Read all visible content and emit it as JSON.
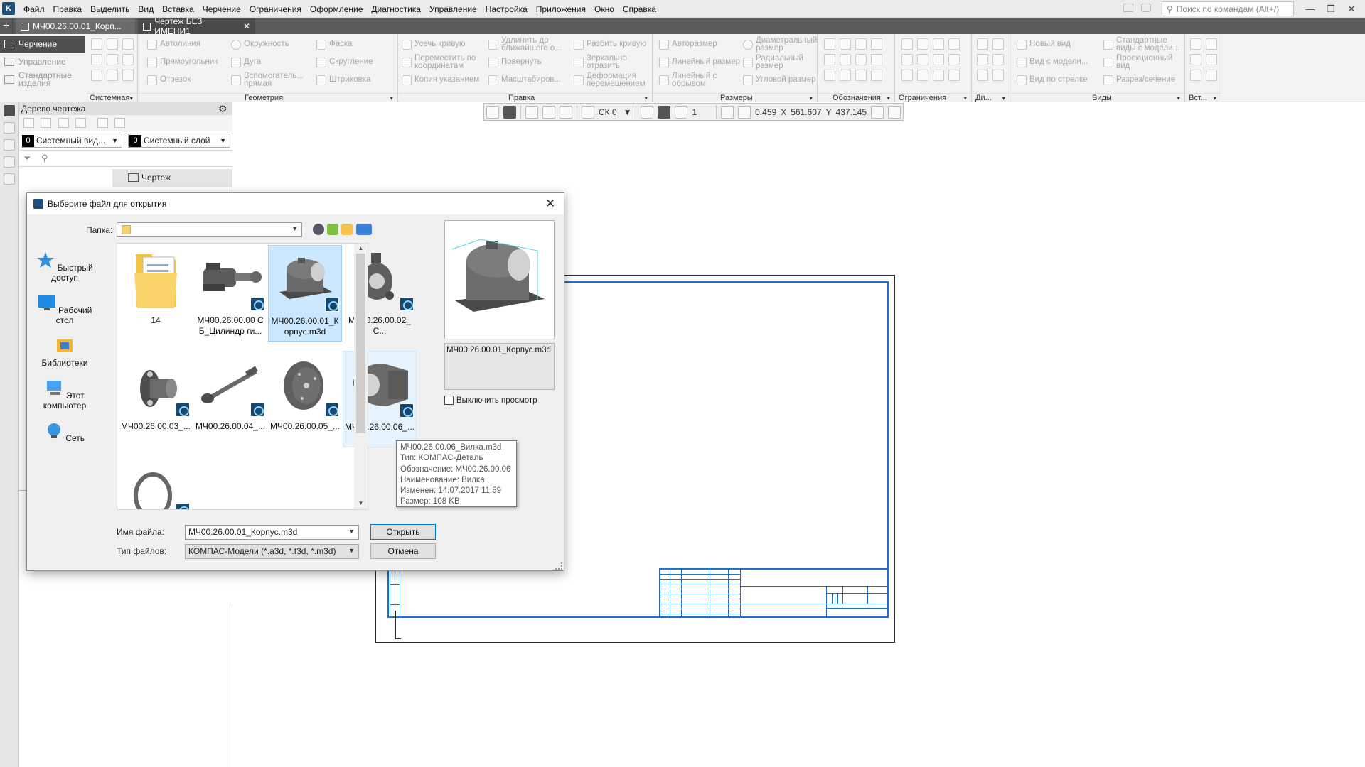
{
  "app": {
    "menu": [
      "Файл",
      "Правка",
      "Выделить",
      "Вид",
      "Вставка",
      "Черчение",
      "Ограничения",
      "Оформление",
      "Диагностика",
      "Управление",
      "Настройка",
      "Приложения",
      "Окно",
      "Справка"
    ],
    "search_placeholder": "Поиск по командам (Alt+/)"
  },
  "tabs": [
    {
      "label": "МЧ00.26.00.01_Корп..."
    },
    {
      "label": "Чертеж БЕЗ ИМЕНИ1",
      "close": "✕"
    }
  ],
  "modes": [
    "Черчение",
    "Управление",
    "Стандартные изделия"
  ],
  "ribbon": {
    "groups": [
      "Системная",
      "Геометрия",
      "Правка",
      "Размеры",
      "Обозначения",
      "Ограничения",
      "Ди...",
      "Виды",
      "Вст..."
    ],
    "geometry": [
      "Автолиния",
      "Окружность",
      "Фаска",
      "Прямоугольник",
      "Дуга",
      "Скругление",
      "Отрезок",
      "Вспомогатель... прямая",
      "Штриховка"
    ],
    "edit": [
      "Усечь кривую",
      "Удлинить до ближайшего о...",
      "Разбить кривую",
      "Переместить по координатам",
      "Повернуть",
      "Зеркально отразить",
      "Копия указанием",
      "Масштабиров...",
      "Деформация перемещением"
    ],
    "dims": [
      "Авторазмер",
      "Диаметральный размер",
      "Линейный размер",
      "Радиальный размер",
      "Линейный с обрывом",
      "Угловой размер"
    ],
    "views": [
      "Новый вид",
      "Стандартные виды с модели...",
      "Вид с модели...",
      "Проекционный вид",
      "Вид по стрелке",
      "Разрез/сечение"
    ]
  },
  "tree": {
    "title": "Дерево чертежа",
    "view_num": "0",
    "view_name": "Системный вид...",
    "layer_num": "0",
    "layer_name": "Системный слой",
    "root_node": "Чертеж"
  },
  "cursor_toolbar": {
    "cs": "СК 0",
    "scale_num": "1",
    "zoom": "0.459",
    "x_label": "X",
    "x_value": "561.607",
    "y_label": "Y",
    "y_value": "437.145"
  },
  "dialog": {
    "title": "Выберите файл для открытия",
    "folder_label": "Папка:",
    "places": [
      "Быстрый доступ",
      "Рабочий стол",
      "Библиотеки",
      "Этот компьютер",
      "Сеть"
    ],
    "files": [
      {
        "name": "14",
        "kind": "folder"
      },
      {
        "name": "МЧ00.26.00.00 СБ_Цилиндр ги...",
        "kind": "model"
      },
      {
        "name": "МЧ00.26.00.01_Корпус.m3d",
        "kind": "model",
        "selected": true
      },
      {
        "name": "МЧ00.26.00.02_С...",
        "kind": "model"
      },
      {
        "name": "МЧ00.26.00.03_...",
        "kind": "model"
      },
      {
        "name": "МЧ00.26.00.04_...",
        "kind": "model"
      },
      {
        "name": "МЧ00.26.00.05_...",
        "kind": "model"
      },
      {
        "name": "МЧ00.26.00.06_...",
        "kind": "model",
        "hovered": true
      },
      {
        "name": "",
        "kind": "model"
      }
    ],
    "preview_name": "МЧ00.26.00.01_Корпус.m3d",
    "no_preview": "Выключить просмотр",
    "file_name_label": "Имя файла:",
    "file_name_value": "МЧ00.26.00.01_Корпус.m3d",
    "file_type_label": "Тип файлов:",
    "file_type_value": "КОМПАС-Модели (*.a3d, *.t3d, *.m3d)",
    "open_button": "Открыть",
    "cancel_button": "Отмена",
    "tooltip": [
      "МЧ00.26.00.06_Вилка.m3d",
      "Тип: КОМПАС-Деталь",
      "Обозначение: МЧ00.26.00.06",
      "Наименование: Вилка",
      "Изменен: 14.07.2017 11:59",
      "Размер: 108 KB"
    ]
  },
  "colors": {
    "accent": "#1e6fcf",
    "dark_ui": "#4f4f4f",
    "selection": "#cce8ff"
  }
}
